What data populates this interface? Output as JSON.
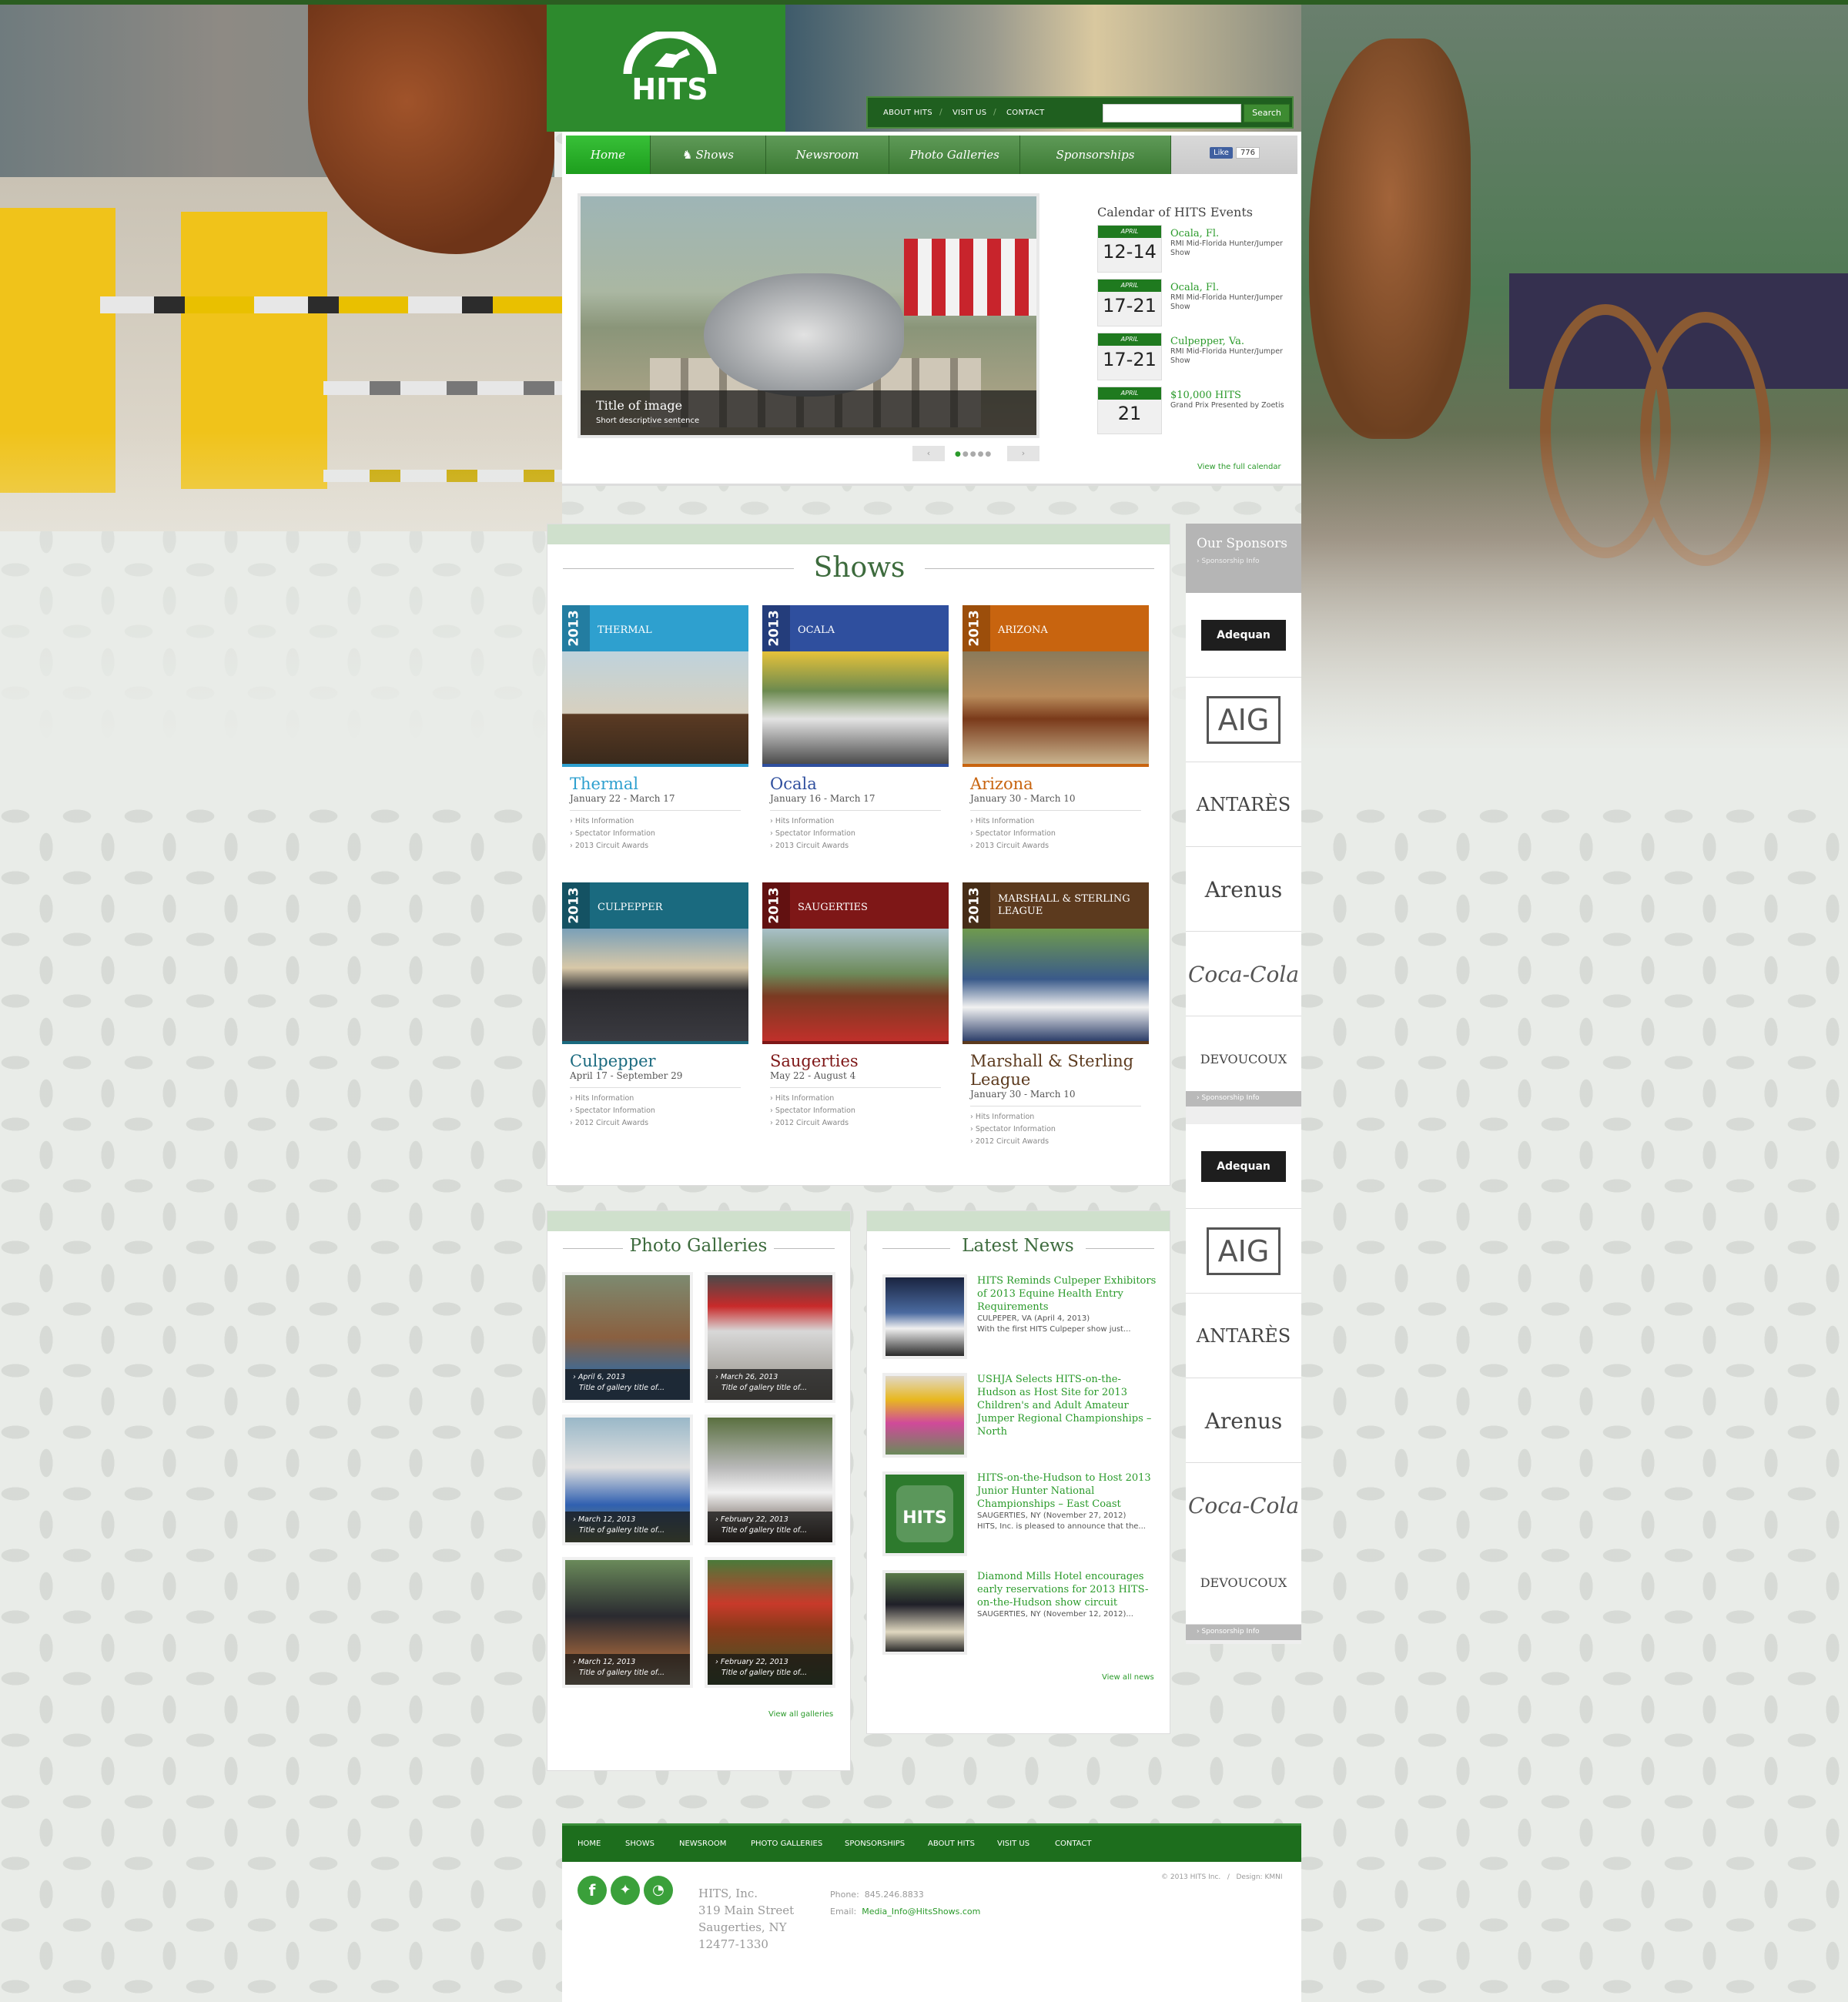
{
  "header": {
    "brand": "HITS",
    "top_links": [
      "ABOUT HITS",
      "VISIT US",
      "CONTACT"
    ],
    "search": {
      "placeholder": "",
      "button_label": "Search"
    }
  },
  "nav": {
    "items": [
      "Home",
      "Shows",
      "Newsroom",
      "Photo Galleries",
      "Sponsorships"
    ],
    "active": "Home",
    "like_label": "Like",
    "like_count": "776"
  },
  "slider": {
    "caption_title": "Title of image",
    "caption_text": "Short descriptive sentence",
    "prev": "‹",
    "next": "›",
    "slides": 5,
    "current": 1
  },
  "calendar": {
    "title": "Calendar of HITS Events",
    "events": [
      {
        "month": "APRIL",
        "days": "12-14",
        "place": "Ocala, Fl.",
        "event": "RMI Mid-Florida Hunter/Jumper Show"
      },
      {
        "month": "APRIL",
        "days": "17-21",
        "place": "Ocala, Fl.",
        "event": "RMI Mid-Florida Hunter/Jumper Show"
      },
      {
        "month": "APRIL",
        "days": "17-21",
        "place": "Culpepper, Va.",
        "event": "RMI Mid-Florida Hunter/Jumper Show"
      },
      {
        "month": "APRIL",
        "days": "21",
        "place": "$10,000 HITS",
        "event": "Grand Prix Presented by Zoetis"
      }
    ],
    "view_all": "View the full calendar"
  },
  "shows": {
    "title": "Shows",
    "cards": [
      {
        "year": "2013",
        "tag": "THERMAL",
        "name": "Thermal",
        "dates": "January 22 - March 17",
        "color": "#2ea0cf",
        "links": [
          "Hits Information",
          "Spectator Information",
          "2013 Circuit Awards"
        ]
      },
      {
        "year": "2013",
        "tag": "OCALA",
        "name": "Ocala",
        "dates": "January 16 - March 17",
        "color": "#2f4f9e",
        "links": [
          "Hits Information",
          "Spectator Information",
          "2013 Circuit Awards"
        ]
      },
      {
        "year": "2013",
        "tag": "ARIZONA",
        "name": "Arizona",
        "dates": "January 30 - March 10",
        "color": "#c8640f",
        "links": [
          "Hits Information",
          "Spectator Information",
          "2013 Circuit Awards"
        ]
      },
      {
        "year": "2013",
        "tag": "CULPEPPER",
        "name": "Culpepper",
        "dates": "April 17 - September 29",
        "color": "#1a6a7f",
        "links": [
          "Hits Information",
          "Spectator Information",
          "2012 Circuit Awards"
        ]
      },
      {
        "year": "2013",
        "tag": "SAUGERTIES",
        "name": "Saugerties",
        "dates": "May 22 - August 4",
        "color": "#7e1717",
        "links": [
          "Hits Information",
          "Spectator Information",
          "2012 Circuit Awards"
        ]
      },
      {
        "year": "2013",
        "tag": "MARSHALL & STERLING LEAGUE",
        "name": "Marshall & Sterling League",
        "dates": "January 30 - March 10",
        "color": "#5c3a1e",
        "links": [
          "Hits Information",
          "Spectator Information",
          "2012 Circuit Awards"
        ]
      }
    ]
  },
  "sponsors": {
    "title": "Our Sponsors",
    "info_label": "› Sponsorship Info",
    "logos": [
      "Adequan",
      "AIG",
      "ANTARÈS",
      "Arenus",
      "Coca-Cola",
      "DEVOUCOUX"
    ]
  },
  "galleries": {
    "title": "Photo Galleries",
    "items": [
      {
        "date": "April 6, 2013",
        "title": "Title of gallery title of..."
      },
      {
        "date": "March 26, 2013",
        "title": "Title of gallery title of..."
      },
      {
        "date": "March 12, 2013",
        "title": "Title of gallery title of..."
      },
      {
        "date": "February 22, 2013",
        "title": "Title of gallery title of..."
      },
      {
        "date": "March 12, 2013",
        "title": "Title of gallery title of..."
      },
      {
        "date": "February 22, 2013",
        "title": "Title of gallery title of..."
      }
    ],
    "view_all": "View all galleries"
  },
  "news": {
    "title": "Latest News",
    "items": [
      {
        "headline": "HITS Reminds Culpeper Exhibitors of 2013 Equine Health Entry Requirements",
        "meta": "CULPEPER, VA (April 4, 2013)",
        "excerpt": "With the first HITS Culpeper show just..."
      },
      {
        "headline": "USHJA Selects HITS-on-the-Hudson as Host Site for 2013 Children's and Adult Amateur Jumper Regional Championships – North",
        "meta": "",
        "excerpt": ""
      },
      {
        "headline": "HITS-on-the-Hudson to Host 2013 Junior Hunter National Championships – East Coast",
        "meta": "SAUGERTIES, NY (November 27, 2012)",
        "excerpt": "HITS, Inc. is pleased to announce that the..."
      },
      {
        "headline": "Diamond Mills Hotel encourages early reservations for 2013 HITS-on-the-Hudson show circuit",
        "meta": "SAUGERTIES, NY (November 12, 2012)...",
        "excerpt": ""
      }
    ],
    "view_all": "View all news"
  },
  "footer": {
    "nav": [
      "HOME",
      "SHOWS",
      "NEWSROOM",
      "PHOTO GALLERIES",
      "SPONSORSHIPS",
      "ABOUT HITS",
      "VISIT US",
      "CONTACT"
    ],
    "credit": "© 2013 HITS Inc.   /   Design: KMNI",
    "address": [
      "HITS, Inc.",
      "319 Main Street",
      "Saugerties, NY",
      "12477-1330"
    ],
    "phone_label": "Phone:",
    "phone": "845.246.8833",
    "email_label": "Email:",
    "email": "Media_Info@HitsShows.com",
    "social": [
      "facebook-icon",
      "twitter-icon",
      "rss-icon"
    ]
  },
  "colors": {
    "brand_green": "#2d8a2d",
    "link_green": "#2a9a2a",
    "footer_green": "#1d6e1d"
  }
}
